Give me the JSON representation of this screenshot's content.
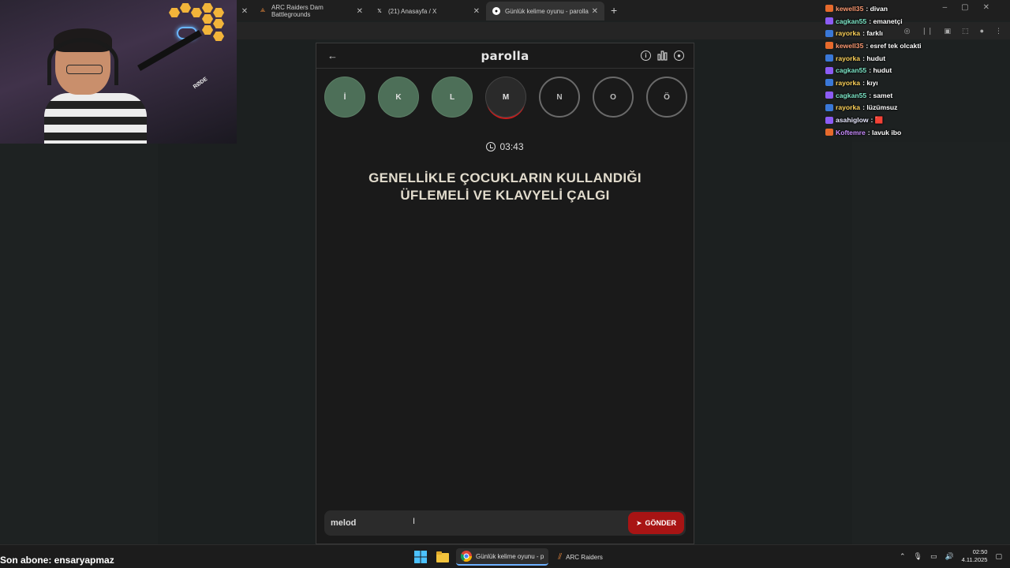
{
  "browser": {
    "tabs": [
      {
        "label": "ARC Raiders Dam Battlegrounds",
        "favicon": "arc-raiders-icon",
        "active": false
      },
      {
        "label": "(21) Anasayfa / X",
        "favicon": "x-icon",
        "active": false
      },
      {
        "label": "Günlük kelime oyunu - parolla",
        "favicon": "parolla-icon",
        "active": true
      }
    ],
    "new_tab": "+"
  },
  "app": {
    "title": "parolla",
    "back": "←",
    "letters": [
      {
        "char": "İ",
        "state": "done"
      },
      {
        "char": "K",
        "state": "done"
      },
      {
        "char": "L",
        "state": "done"
      },
      {
        "char": "M",
        "state": "current"
      },
      {
        "char": "N",
        "state": "todo"
      },
      {
        "char": "O",
        "state": "todo"
      },
      {
        "char": "Ö",
        "state": "todo"
      }
    ],
    "timer": "03:43",
    "question_line1": "GENELLİKLE ÇOCUKLARIN KULLANDIĞI",
    "question_line2": "ÜFLEMELİ VE KLAVYELİ ÇALGI",
    "answer_value": "melod",
    "send_label": "GÖNDER",
    "accent": "#a81414",
    "done_color": "#4d6f58"
  },
  "chat": [
    {
      "user": "kewell35",
      "msg": "divan",
      "color": "#ff9b73",
      "badge": "#e66a2c"
    },
    {
      "user": "cagkan55",
      "msg": "emanetçi",
      "color": "#7ee8c9",
      "badge": "#8c5cf5"
    },
    {
      "user": "rayorka",
      "msg": "farklı",
      "color": "#ffd45c",
      "badge": "#3a78d8"
    },
    {
      "user": "kewell35",
      "msg": "esref tek olcakti",
      "color": "#ff9b73",
      "badge": "#e66a2c"
    },
    {
      "user": "rayorka",
      "msg": "hudut",
      "color": "#ffd45c",
      "badge": "#3a78d8"
    },
    {
      "user": "cagkan55",
      "msg": "hudut",
      "color": "#7ee8c9",
      "badge": "#8c5cf5"
    },
    {
      "user": "rayorka",
      "msg": "kıyı",
      "color": "#ffd45c",
      "badge": "#3a78d8"
    },
    {
      "user": "cagkan55",
      "msg": "samet",
      "color": "#7ee8c9",
      "badge": "#8c5cf5"
    },
    {
      "user": "rayorka",
      "msg": "lüzümsuz",
      "color": "#ffd45c",
      "badge": "#3a78d8"
    },
    {
      "user": "asahiglow",
      "msg": "🟥",
      "color": "#e8e8ff",
      "badge": "#8c5cf5"
    },
    {
      "user": "Koftemre",
      "msg": "lavuk ibo",
      "color": "#c98cff",
      "badge": "#e66a2c"
    }
  ],
  "stream": {
    "last_sub": "Son abone: ensaryapmaz"
  },
  "taskbar": {
    "apps": [
      {
        "label": "Günlük kelime oyunu - p",
        "icon": "chrome-icon",
        "active": true
      },
      {
        "label": "ARC Raiders",
        "icon": "arc-raiders-icon",
        "active": false
      }
    ],
    "time": "02:50",
    "date": "4.11.2025"
  }
}
